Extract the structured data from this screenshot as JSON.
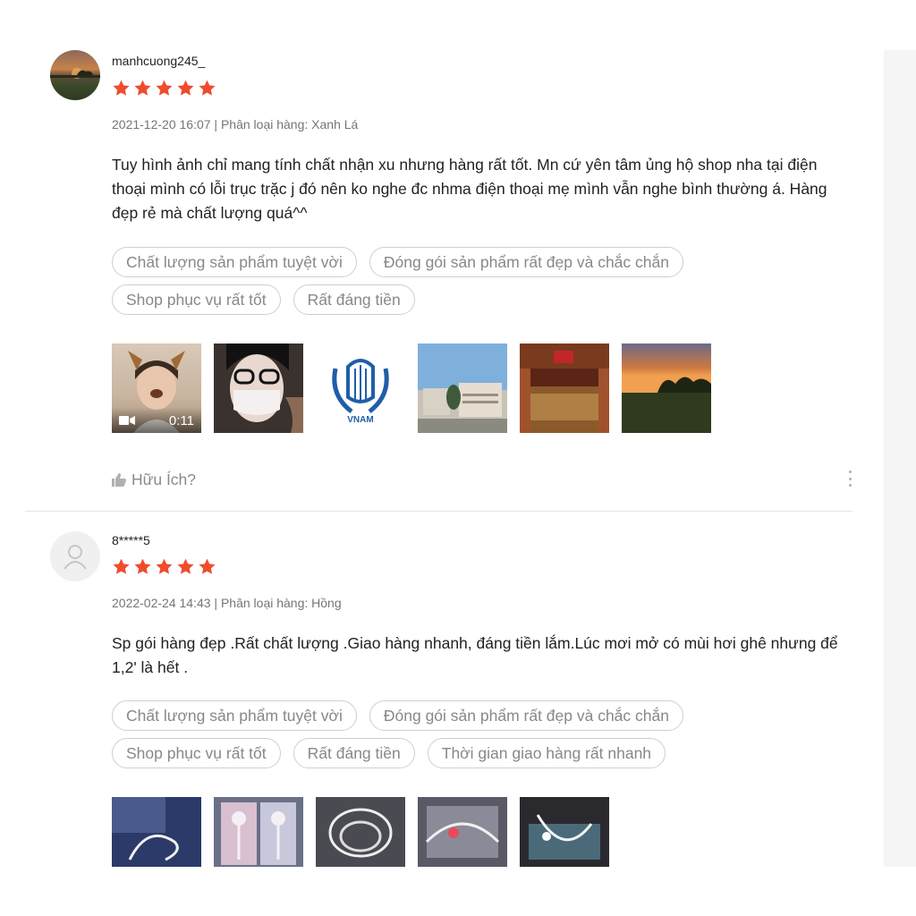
{
  "colors": {
    "star": "#ee4d2d",
    "tag_border": "#cfcfcf",
    "muted_text": "#757575"
  },
  "reviews": [
    {
      "username": "manhcuong245_",
      "rating": 5,
      "timestamp": "2021-12-20 16:07",
      "variation": "Phân loại hàng: Xanh Lá",
      "comment": "Tuy hình ảnh chỉ mang tính chất nhận xu nhưng hàng rất tốt. Mn cứ yên tâm ủng hộ shop nha tại điện thoại mình có lỗi trục trặc j đó nên ko nghe đc nhma điện thoại mẹ mình vẫn nghe bình thường á. Hàng đẹp rẻ mà chất lượng quá^^",
      "tags": [
        "Chất lượng sản phẩm tuyệt vời",
        "Đóng gói sản phẩm rất đẹp và chắc chắn",
        "Shop phục vụ rất tốt",
        "Rất đáng tiền"
      ],
      "video_duration": "0:11",
      "thumb_logo_text": "VNAM",
      "helpful_label": "Hữu Ích?"
    },
    {
      "username": "8*****5",
      "rating": 5,
      "timestamp": "2022-02-24 14:43",
      "variation": "Phân loại hàng: Hồng",
      "comment": "Sp gói hàng đẹp .Rất chất lượng .Giao hàng nhanh, đáng tiền lắm.Lúc mơi mở có mùi hơi ghê nhưng để 1,2' là hết .",
      "tags": [
        "Chất lượng sản phẩm tuyệt vời",
        "Đóng gói sản phẩm rất đẹp và chắc chắn",
        "Shop phục vụ rất tốt",
        "Rất đáng tiền",
        "Thời gian giao hàng rất nhanh"
      ]
    }
  ]
}
